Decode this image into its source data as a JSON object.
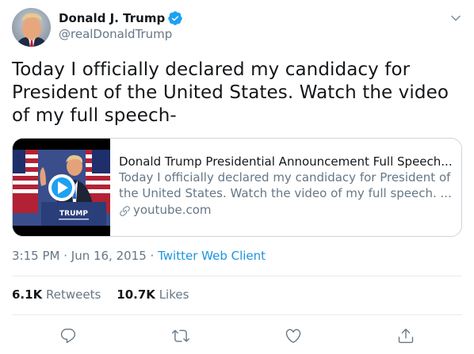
{
  "author": {
    "display_name": "Donald J. Trump",
    "handle": "@realDonaldTrump",
    "verified": true
  },
  "tweet": {
    "text": "Today I officially declared my candidacy for President of the United States. Watch the video of my full speech-"
  },
  "card": {
    "title": "Donald Trump Presidential Announcement Full Speech...",
    "description": "Today I officially declared my candidacy for President of the United States. Watch the video of my full speech. ...",
    "domain": "youtube.com",
    "thumb_label": "TRUMP"
  },
  "meta": {
    "time": "3:15 PM",
    "separator1": " · ",
    "date": "Jun 16, 2015",
    "separator2": " · ",
    "source": "Twitter Web Client"
  },
  "stats": {
    "retweets_count": "6.1K",
    "retweets_label": "Retweets",
    "likes_count": "10.7K",
    "likes_label": "Likes"
  },
  "actions": [
    "reply-icon",
    "retweet-icon",
    "like-icon",
    "share-icon"
  ],
  "colors": {
    "accent": "#1da1f2",
    "link": "#1b95e0",
    "muted": "#657786",
    "border": "#ccd6dd"
  }
}
